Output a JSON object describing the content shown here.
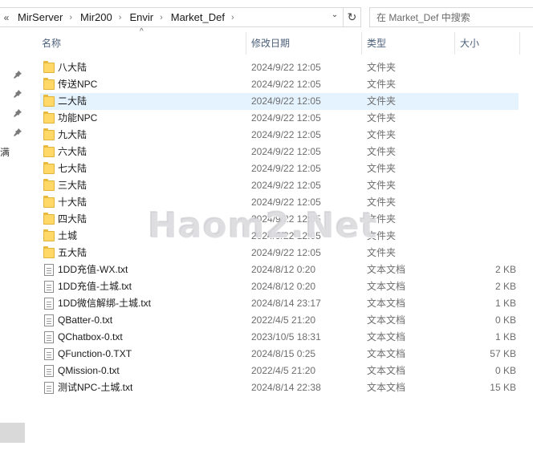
{
  "address": {
    "more": "«",
    "crumbs": [
      "MirServer",
      "Mir200",
      "Envir",
      "Market_Def"
    ],
    "separator": "›",
    "dropdown": "⌄",
    "refresh": "↻"
  },
  "search": {
    "placeholder": "在 Market_Def 中搜索"
  },
  "columns": {
    "name": "名称",
    "date": "修改日期",
    "type": "类型",
    "size": "大小",
    "sort_indicator": "^"
  },
  "nav": {
    "pin_icon": "pin-icon",
    "glyph": "满"
  },
  "files": [
    {
      "name": "八大陆",
      "date": "2024/9/22 12:05",
      "type": "文件夹",
      "size": "",
      "icon": "folder-icon"
    },
    {
      "name": "传送NPC",
      "date": "2024/9/22 12:05",
      "type": "文件夹",
      "size": "",
      "icon": "folder-icon"
    },
    {
      "name": "二大陆",
      "date": "2024/9/22 12:05",
      "type": "文件夹",
      "size": "",
      "icon": "folder-icon",
      "selected": true
    },
    {
      "name": "功能NPC",
      "date": "2024/9/22 12:05",
      "type": "文件夹",
      "size": "",
      "icon": "folder-icon"
    },
    {
      "name": "九大陆",
      "date": "2024/9/22 12:05",
      "type": "文件夹",
      "size": "",
      "icon": "folder-icon"
    },
    {
      "name": "六大陆",
      "date": "2024/9/22 12:05",
      "type": "文件夹",
      "size": "",
      "icon": "folder-icon"
    },
    {
      "name": "七大陆",
      "date": "2024/9/22 12:05",
      "type": "文件夹",
      "size": "",
      "icon": "folder-icon"
    },
    {
      "name": "三大陆",
      "date": "2024/9/22 12:05",
      "type": "文件夹",
      "size": "",
      "icon": "folder-icon"
    },
    {
      "name": "十大陆",
      "date": "2024/9/22 12:05",
      "type": "文件夹",
      "size": "",
      "icon": "folder-icon"
    },
    {
      "name": "四大陆",
      "date": "2024/9/22 12:05",
      "type": "文件夹",
      "size": "",
      "icon": "folder-icon"
    },
    {
      "name": "土城",
      "date": "2024/9/22 12:05",
      "type": "文件夹",
      "size": "",
      "icon": "folder-icon"
    },
    {
      "name": "五大陆",
      "date": "2024/9/22 12:05",
      "type": "文件夹",
      "size": "",
      "icon": "folder-icon"
    },
    {
      "name": "1DD充值-WX.txt",
      "date": "2024/8/12 0:20",
      "type": "文本文档",
      "size": "2 KB",
      "icon": "text-file-icon"
    },
    {
      "name": "1DD充值-土城.txt",
      "date": "2024/8/12 0:20",
      "type": "文本文档",
      "size": "2 KB",
      "icon": "text-file-icon"
    },
    {
      "name": "1DD微信解绑-土城.txt",
      "date": "2024/8/14 23:17",
      "type": "文本文档",
      "size": "1 KB",
      "icon": "text-file-icon"
    },
    {
      "name": "QBatter-0.txt",
      "date": "2022/4/5 21:20",
      "type": "文本文档",
      "size": "0 KB",
      "icon": "text-file-icon"
    },
    {
      "name": "QChatbox-0.txt",
      "date": "2023/10/5 18:31",
      "type": "文本文档",
      "size": "1 KB",
      "icon": "text-file-icon"
    },
    {
      "name": "QFunction-0.TXT",
      "date": "2024/8/15 0:25",
      "type": "文本文档",
      "size": "57 KB",
      "icon": "text-file-icon"
    },
    {
      "name": "QMission-0.txt",
      "date": "2022/4/5 21:20",
      "type": "文本文档",
      "size": "0 KB",
      "icon": "text-file-icon"
    },
    {
      "name": "测试NPC-土城.txt",
      "date": "2024/8/14 22:38",
      "type": "文本文档",
      "size": "15 KB",
      "icon": "text-file-icon"
    }
  ],
  "watermark": "Haom2.Net"
}
